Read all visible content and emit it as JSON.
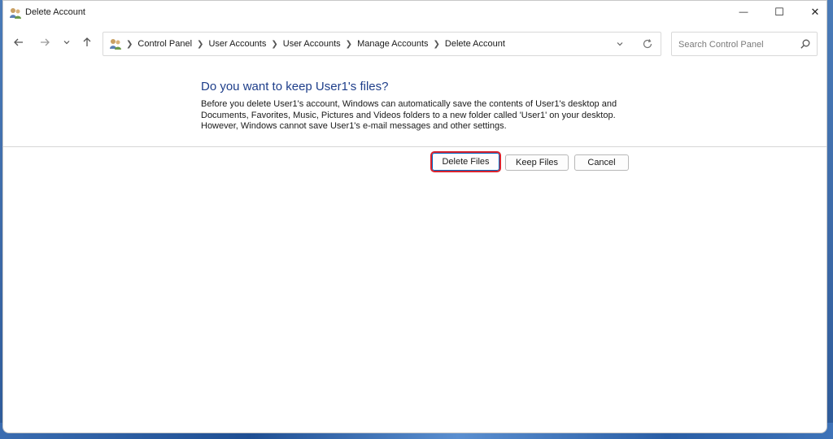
{
  "window": {
    "title": "Delete Account",
    "controls": {
      "minimize": "—",
      "maximize": "☐",
      "close": "✕"
    }
  },
  "nav": {
    "back_icon": "arrow-left-icon",
    "forward_icon": "arrow-right-icon",
    "recent_icon": "chevron-down-icon",
    "up_icon": "arrow-up-icon"
  },
  "address": {
    "crumbs": [
      "Control Panel",
      "User Accounts",
      "User Accounts",
      "Manage Accounts",
      "Delete Account"
    ]
  },
  "search": {
    "placeholder": "Search Control Panel"
  },
  "content": {
    "heading": "Do you want to keep User1's files?",
    "lines": [
      "Before you delete User1's account, Windows can automatically save the contents of User1's desktop and",
      "Documents, Favorites, Music, Pictures and Videos folders to a new folder called 'User1' on your desktop.",
      "However, Windows cannot save User1's e-mail messages and other settings."
    ]
  },
  "buttons": {
    "delete_files": "Delete Files",
    "keep_files": "Keep Files",
    "cancel": "Cancel"
  },
  "colors": {
    "heading": "#1e3e8a",
    "highlight": "#d9232e"
  }
}
